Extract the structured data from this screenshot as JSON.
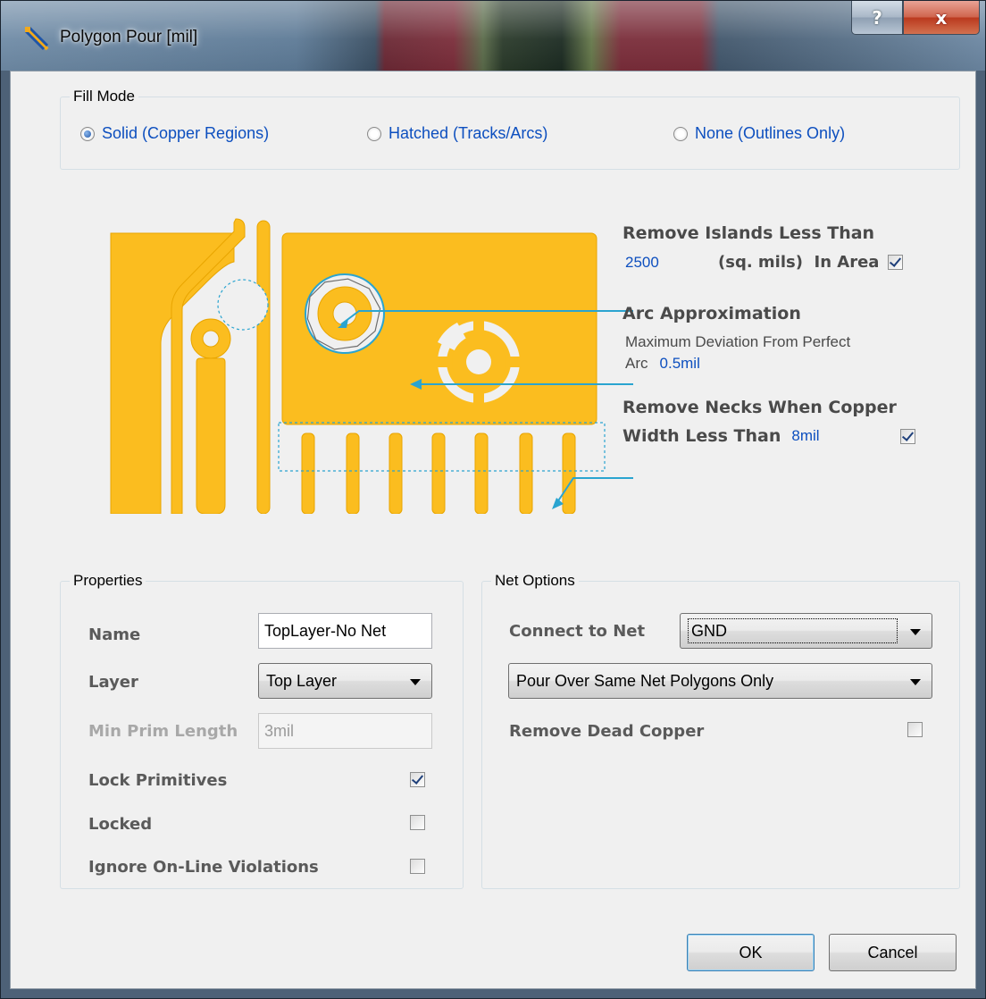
{
  "window": {
    "title": "Polygon Pour [mil]",
    "help_glyph": "?",
    "close_glyph": "x"
  },
  "fill_mode": {
    "title": "Fill Mode",
    "options": [
      {
        "label": "Solid (Copper Regions)",
        "checked": true
      },
      {
        "label": "Hatched (Tracks/Arcs)",
        "checked": false
      },
      {
        "label": "None (Outlines Only)",
        "checked": false
      }
    ]
  },
  "remove_islands": {
    "title": "Remove Islands Less Than",
    "value": "2500",
    "suffix": "(sq. mils)  In Area",
    "checked": true
  },
  "arc_approx": {
    "title": "Arc Approximation",
    "line1": "Maximum Deviation From Perfect",
    "prefix": "Arc",
    "value": "0.5mil"
  },
  "remove_necks": {
    "title_line1": "Remove Necks When Copper",
    "title_line2": "Width Less Than",
    "value": "8mil",
    "checked": true
  },
  "properties": {
    "title": "Properties",
    "name_label": "Name",
    "name_value": "TopLayer-No Net",
    "layer_label": "Layer",
    "layer_value": "Top Layer",
    "min_prim_label": "Min Prim Length",
    "min_prim_value": "3mil",
    "lock_primitives_label": "Lock Primitives",
    "lock_primitives": true,
    "locked_label": "Locked",
    "locked": false,
    "ignore_label": "Ignore On-Line Violations",
    "ignore": false
  },
  "net_options": {
    "title": "Net Options",
    "connect_label": "Connect to Net",
    "connect_value": "GND",
    "pour_value": "Pour Over Same Net Polygons Only",
    "remove_dead_label": "Remove Dead Copper",
    "remove_dead": false
  },
  "buttons": {
    "ok": "OK",
    "cancel": "Cancel"
  },
  "colors": {
    "copper": "#fbbd1f",
    "link_blue": "#0d4fbf",
    "annotation_line": "#2aa4d0"
  }
}
